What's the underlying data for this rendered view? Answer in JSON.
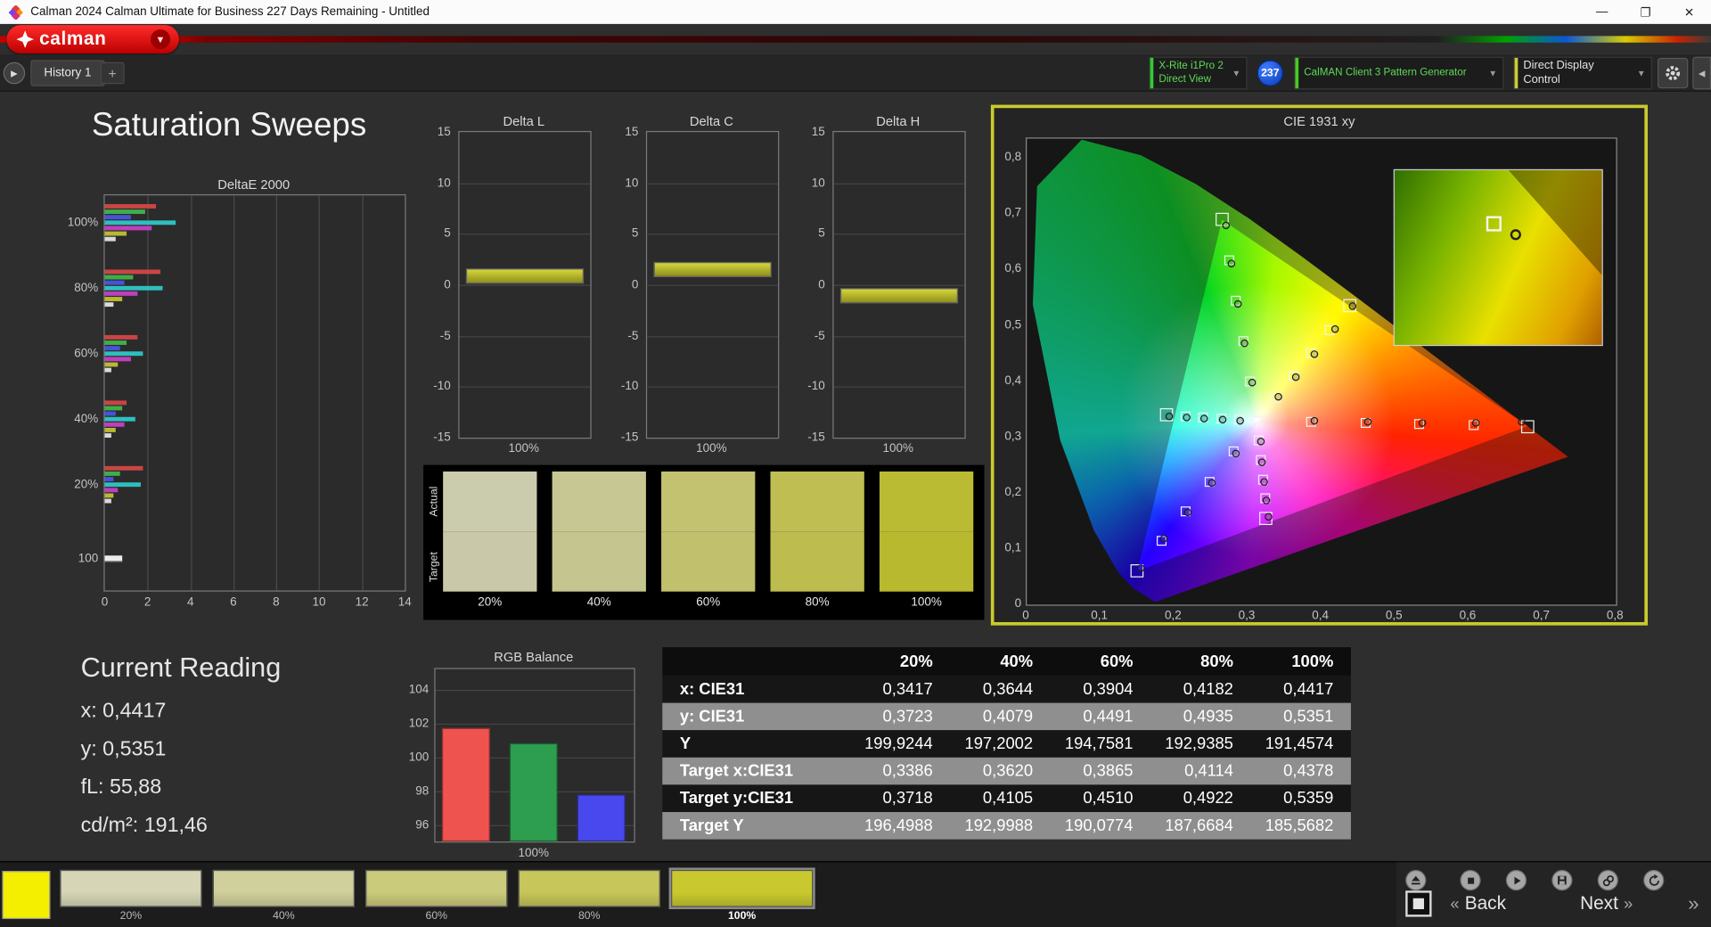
{
  "titlebar": {
    "title": "Calman 2024 Calman Ultimate for Business 227 Days Remaining  - Untitled",
    "minimize": "—",
    "maximize": "❐",
    "close": "✕"
  },
  "brand": {
    "logo_text": "calman"
  },
  "tabbar": {
    "history_tab": "History 1",
    "add_tab": "+"
  },
  "device_bar": {
    "meter_line1": "X-Rite i1Pro 2",
    "meter_line2": "Direct View",
    "meter_badge": "237",
    "pattern_generator": "CalMAN Client 3 Pattern Generator",
    "display_control": "Direct Display Control"
  },
  "page_title": "Saturation Sweeps",
  "current_reading": {
    "title": "Current Reading",
    "lines": [
      "x: 0,4417",
      "y: 0,5351",
      "fL: 55,88",
      "cd/m²: 191,46"
    ]
  },
  "bottom_bar": {
    "active_color": "#f4ee00",
    "swatches": [
      {
        "label": "20%",
        "color": "#d6d6b6",
        "selected": false
      },
      {
        "label": "40%",
        "color": "#d0d09c",
        "selected": false
      },
      {
        "label": "60%",
        "color": "#cbcb7c",
        "selected": false
      },
      {
        "label": "80%",
        "color": "#c6c65a",
        "selected": false
      },
      {
        "label": "100%",
        "color": "#c9c92f",
        "selected": true
      }
    ],
    "back_chevron": "«",
    "back_label": "Back",
    "next_label": "Next",
    "next_chevron": "»"
  },
  "chart_data": [
    {
      "id": "deltae2000",
      "type": "bar",
      "orientation": "horizontal",
      "title": "DeltaE 2000",
      "xlim": [
        0,
        14
      ],
      "xticks": [
        0,
        2,
        4,
        6,
        8,
        10,
        12,
        14
      ],
      "series_colors": [
        "#c94545",
        "#3fae4a",
        "#4653d8",
        "#2fbfbf",
        "#bf3fbf",
        "#b8b832",
        "#d9d9d9"
      ],
      "groups": [
        {
          "label": "100%",
          "values": [
            2.4,
            1.9,
            1.2,
            3.3,
            2.2,
            1.0,
            0.5
          ]
        },
        {
          "label": "80%",
          "values": [
            2.6,
            1.3,
            0.9,
            2.7,
            1.5,
            0.8,
            0.4
          ]
        },
        {
          "label": "60%",
          "values": [
            1.5,
            1.0,
            0.7,
            1.8,
            1.2,
            0.6,
            0.3
          ]
        },
        {
          "label": "40%",
          "values": [
            1.0,
            0.8,
            0.5,
            1.4,
            0.9,
            0.5,
            0.3
          ]
        },
        {
          "label": "20%",
          "values": [
            1.8,
            0.7,
            0.4,
            1.7,
            0.6,
            0.4,
            0.3
          ]
        },
        {
          "label": "100",
          "values": [
            0.8
          ]
        }
      ]
    },
    {
      "id": "deltaL",
      "type": "bar",
      "title": "Delta L",
      "ylim": [
        -15,
        15
      ],
      "yticks": [
        15,
        10,
        5,
        0,
        -5,
        -10,
        -15
      ],
      "xlabel": "100%",
      "value": 0.9,
      "bar_color": "#b9b931"
    },
    {
      "id": "deltaC",
      "type": "bar",
      "title": "Delta C",
      "ylim": [
        -15,
        15
      ],
      "yticks": [
        15,
        10,
        5,
        0,
        -5,
        -10,
        -15
      ],
      "xlabel": "100%",
      "value": 1.5,
      "bar_color": "#b9b931"
    },
    {
      "id": "deltaH",
      "type": "bar",
      "title": "Delta H",
      "ylim": [
        -15,
        15
      ],
      "yticks": [
        15,
        10,
        5,
        0,
        -5,
        -10,
        -15
      ],
      "xlabel": "100%",
      "value": -1.1,
      "bar_color": "#b9b931"
    },
    {
      "id": "saturation_swatches",
      "type": "swatch-compare",
      "row_labels": [
        "Actual",
        "Target"
      ],
      "items": [
        {
          "label": "20%",
          "actual": "#cbcbad",
          "target": "#c9c9a9"
        },
        {
          "label": "40%",
          "actual": "#c7c793",
          "target": "#c5c58f"
        },
        {
          "label": "60%",
          "actual": "#c2c271",
          "target": "#c0c06d"
        },
        {
          "label": "80%",
          "actual": "#bebe53",
          "target": "#bcbc4f"
        },
        {
          "label": "100%",
          "actual": "#bbbb33",
          "target": "#b9b930"
        }
      ]
    },
    {
      "id": "cie1931",
      "type": "scatter",
      "title": "CIE 1931 xy",
      "xlim": [
        0,
        0.8
      ],
      "ylim": [
        0,
        0.8
      ],
      "xtick_labels": [
        "0",
        "0,1",
        "0,2",
        "0,3",
        "0,4",
        "0,5",
        "0,6",
        "0,7",
        "0,8"
      ],
      "ytick_labels": [
        "0,8",
        "0,7",
        "0,6",
        "0,5",
        "0,4",
        "0,3",
        "0,2",
        "0,1",
        "0"
      ],
      "white_point": [
        0.3127,
        0.329
      ],
      "sweeps": [
        {
          "name": "yellow",
          "targets": [
            [
              0.3386,
              0.3718
            ],
            [
              0.362,
              0.4105
            ],
            [
              0.3865,
              0.451
            ],
            [
              0.4114,
              0.4922
            ],
            [
              0.4378,
              0.5359
            ]
          ],
          "measured": [
            [
              0.3417,
              0.3723
            ],
            [
              0.3644,
              0.4079
            ],
            [
              0.3904,
              0.4491
            ],
            [
              0.4182,
              0.4935
            ],
            [
              0.4417,
              0.5351
            ]
          ]
        },
        {
          "name": "red",
          "targets": [
            [
              0.386,
              0.327
            ],
            [
              0.46,
              0.325
            ],
            [
              0.533,
              0.324
            ],
            [
              0.607,
              0.322
            ],
            [
              0.68,
              0.32
            ]
          ],
          "measured": [
            [
              0.39,
              0.329
            ],
            [
              0.463,
              0.328
            ],
            [
              0.537,
              0.326
            ],
            [
              0.61,
              0.325
            ],
            [
              0.672,
              0.327
            ]
          ]
        },
        {
          "name": "green",
          "targets": [
            [
              0.303,
              0.401
            ],
            [
              0.294,
              0.473
            ],
            [
              0.284,
              0.546
            ],
            [
              0.275,
              0.618
            ],
            [
              0.265,
              0.69
            ]
          ],
          "measured": [
            [
              0.306,
              0.398
            ],
            [
              0.296,
              0.468
            ],
            [
              0.287,
              0.54
            ],
            [
              0.278,
              0.611
            ],
            [
              0.27,
              0.68
            ]
          ]
        },
        {
          "name": "blue",
          "targets": [
            [
              0.28,
              0.275
            ],
            [
              0.248,
              0.221
            ],
            [
              0.215,
              0.168
            ],
            [
              0.183,
              0.114
            ],
            [
              0.15,
              0.06
            ]
          ],
          "measured": [
            [
              0.283,
              0.272
            ],
            [
              0.251,
              0.218
            ],
            [
              0.219,
              0.165
            ],
            [
              0.186,
              0.118
            ],
            [
              0.155,
              0.066
            ]
          ]
        },
        {
          "name": "cyan",
          "targets": [
            [
              0.288,
              0.331
            ],
            [
              0.264,
              0.333
            ],
            [
              0.239,
              0.336
            ],
            [
              0.215,
              0.338
            ],
            [
              0.19,
              0.34
            ]
          ],
          "measured": [
            [
              0.29,
              0.33
            ],
            [
              0.266,
              0.332
            ],
            [
              0.241,
              0.334
            ],
            [
              0.217,
              0.336
            ],
            [
              0.193,
              0.338
            ]
          ]
        },
        {
          "name": "magenta",
          "targets": [
            [
              0.315,
              0.294
            ],
            [
              0.318,
              0.259
            ],
            [
              0.32,
              0.224
            ],
            [
              0.323,
              0.19
            ],
            [
              0.325,
              0.155
            ]
          ],
          "measured": [
            [
              0.317,
              0.292
            ],
            [
              0.319,
              0.256
            ],
            [
              0.322,
              0.221
            ],
            [
              0.325,
              0.187
            ],
            [
              0.328,
              0.158
            ]
          ]
        }
      ]
    },
    {
      "id": "rgb_balance",
      "type": "bar",
      "title": "RGB Balance",
      "categories": [
        "Red",
        "Green",
        "Blue"
      ],
      "values": [
        101.7,
        100.8,
        97.8
      ],
      "colors": [
        "#ef5350",
        "#2d9e4f",
        "#4848ee"
      ],
      "ylim": [
        95,
        105.2
      ],
      "yticks": [
        104,
        102,
        100,
        98,
        96
      ],
      "xlabel": "100%"
    },
    {
      "id": "cie_table",
      "type": "table",
      "columns": [
        "",
        "20%",
        "40%",
        "60%",
        "80%",
        "100%"
      ],
      "rows": [
        {
          "label": "x: CIE31",
          "values": [
            "0,3417",
            "0,3644",
            "0,3904",
            "0,4182",
            "0,4417"
          ]
        },
        {
          "label": "y: CIE31",
          "values": [
            "0,3723",
            "0,4079",
            "0,4491",
            "0,4935",
            "0,5351"
          ]
        },
        {
          "label": "Y",
          "values": [
            "199,9244",
            "197,2002",
            "194,7581",
            "192,9385",
            "191,4574"
          ]
        },
        {
          "label": "Target x:CIE31",
          "values": [
            "0,3386",
            "0,3620",
            "0,3865",
            "0,4114",
            "0,4378"
          ]
        },
        {
          "label": "Target y:CIE31",
          "values": [
            "0,3718",
            "0,4105",
            "0,4510",
            "0,4922",
            "0,5359"
          ]
        },
        {
          "label": "Target Y",
          "values": [
            "196,4988",
            "192,9988",
            "190,0774",
            "187,6684",
            "185,5682"
          ]
        }
      ]
    }
  ]
}
